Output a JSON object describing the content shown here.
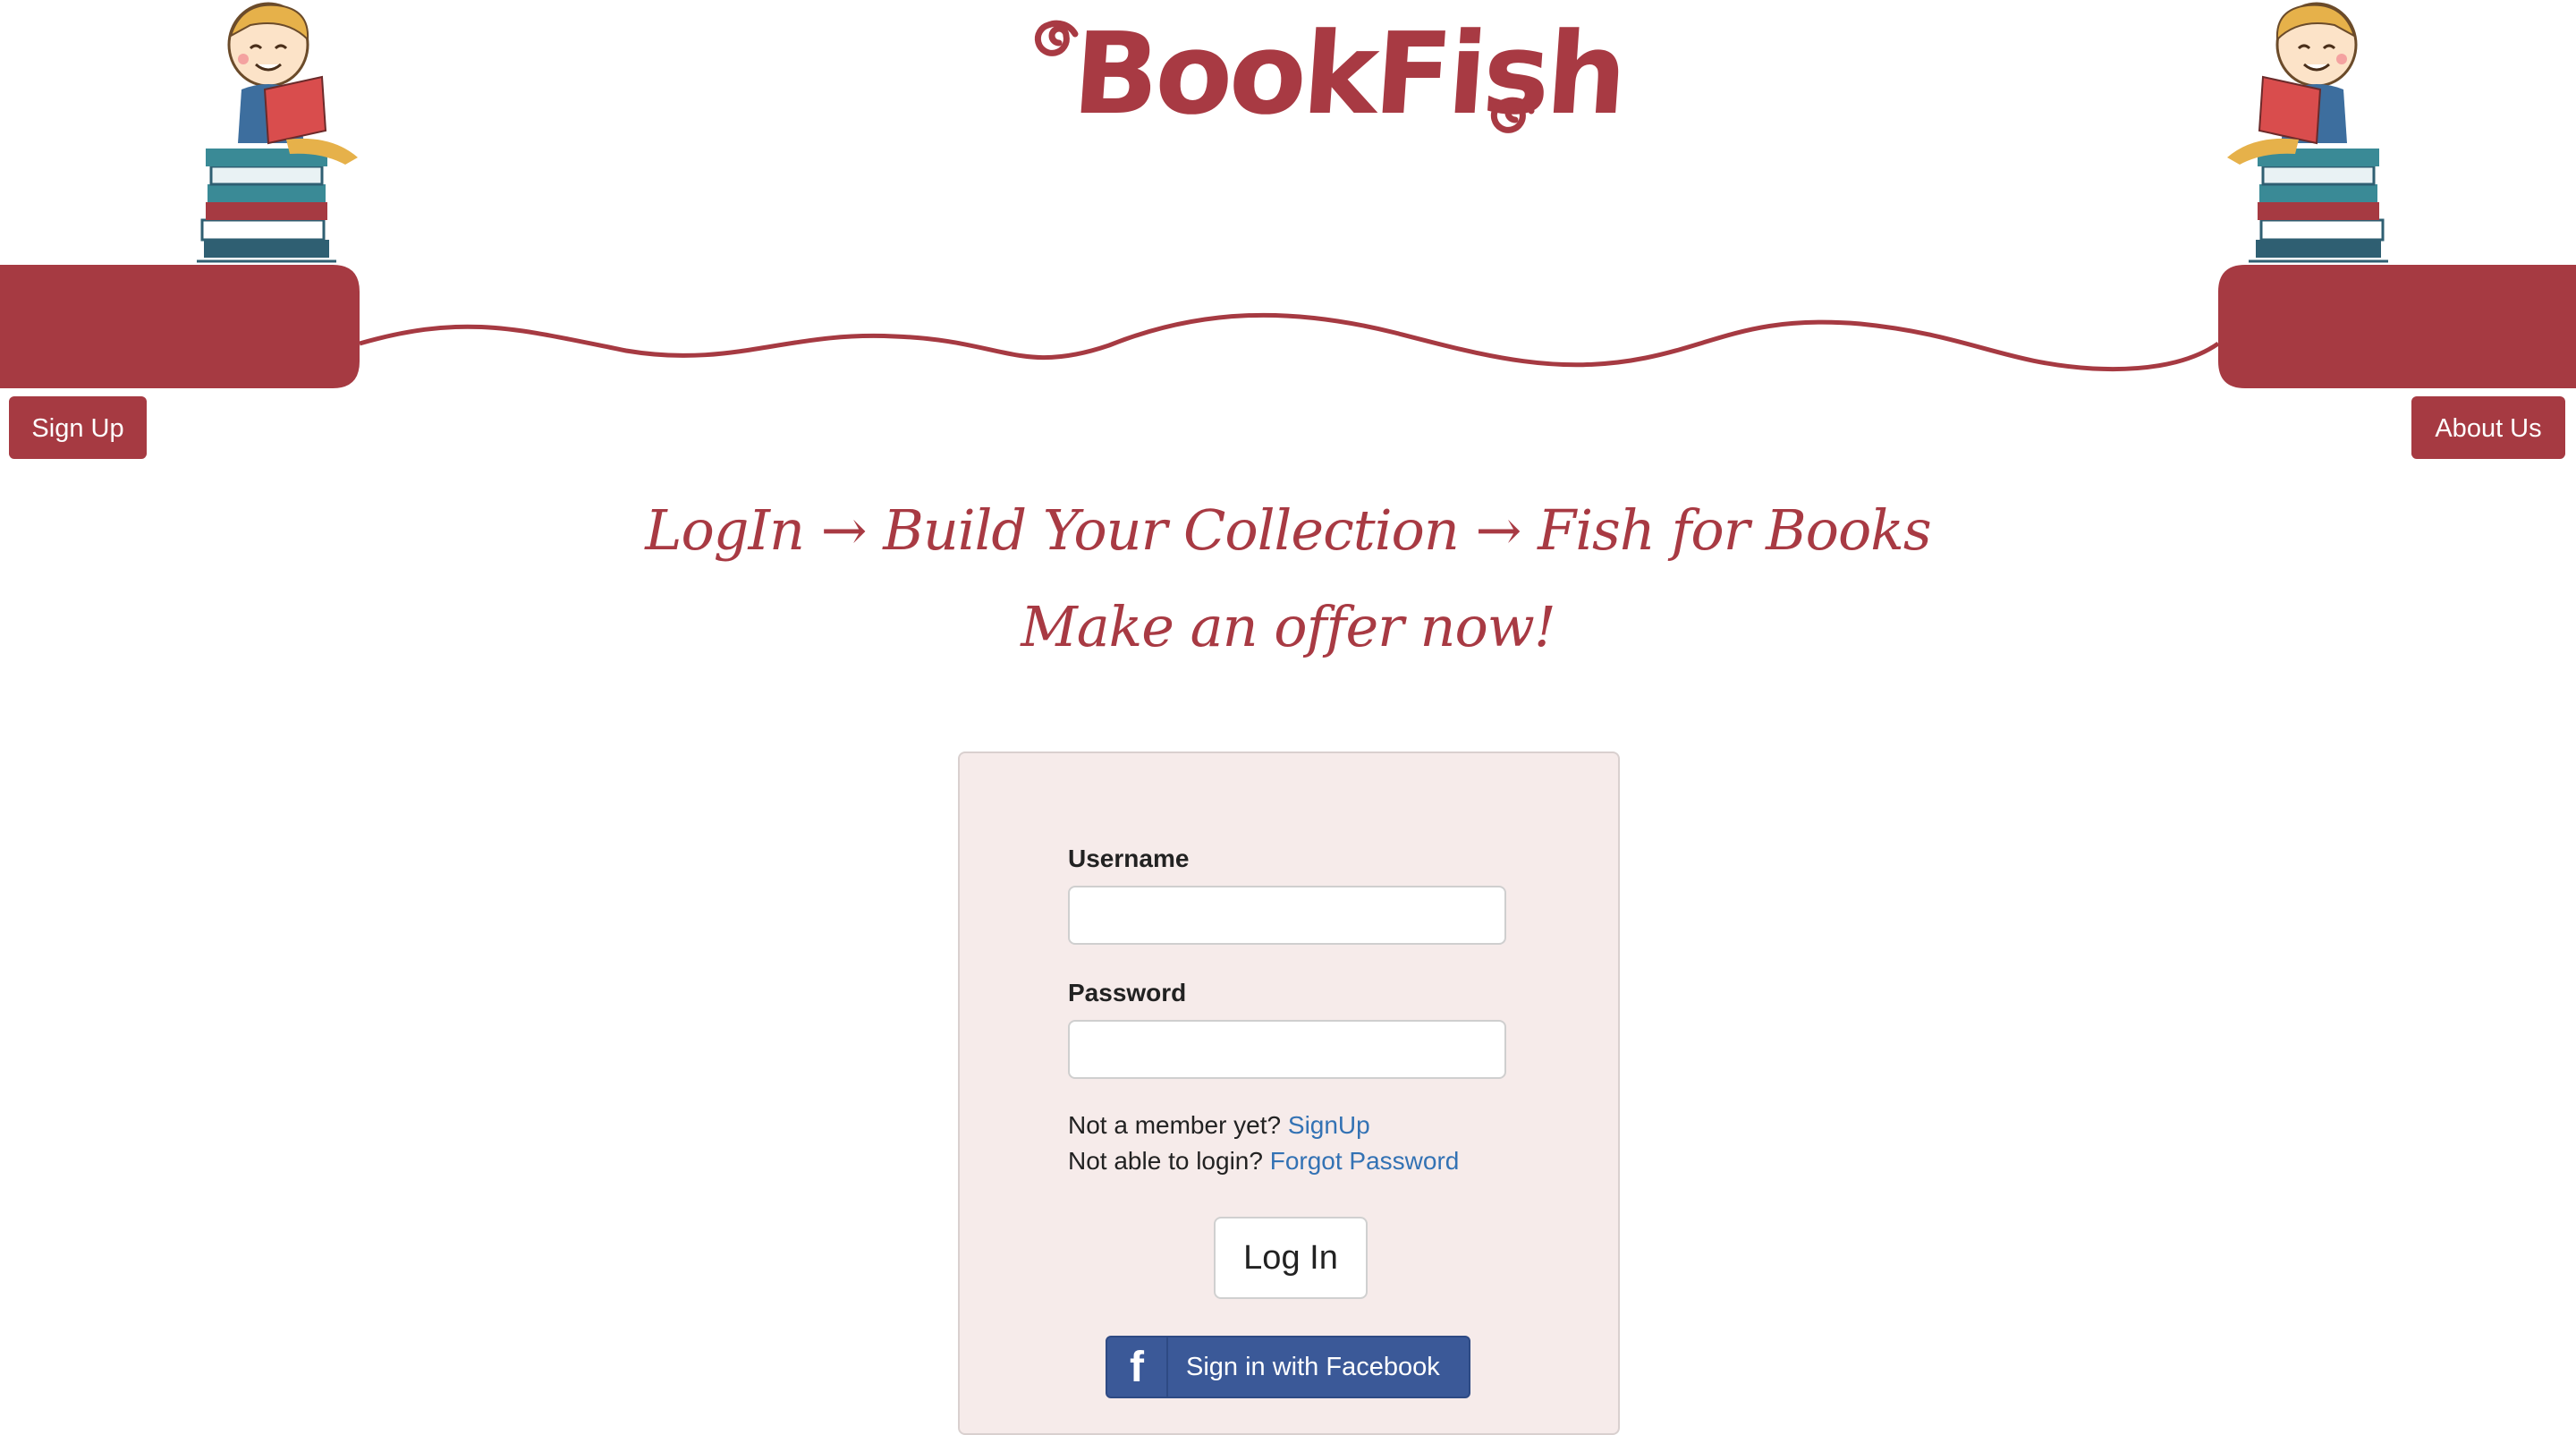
{
  "header": {
    "logo_text": "BookFish",
    "sign_up_label": "Sign Up",
    "about_label": "About Us",
    "icons": [
      "swirl-icon",
      "reading-kid-icon"
    ]
  },
  "tagline": {
    "line1": "LogIn → Build Your Collection → Fish for Books",
    "line2": "Make an offer now!"
  },
  "login_form": {
    "username_label": "Username",
    "username_value": "",
    "password_label": "Password",
    "password_value": "",
    "not_member_text": "Not a member yet?",
    "signup_link": "SignUp",
    "cant_login_text": "Not able to login?",
    "forgot_link": "Forgot Password",
    "login_button": "Log In",
    "facebook_button": "Sign in with Facebook",
    "facebook_icon": "f"
  },
  "colors": {
    "brand": "#a63a42",
    "panel_bg": "#f6ebea",
    "link": "#3372b4",
    "facebook": "#3b5998"
  }
}
